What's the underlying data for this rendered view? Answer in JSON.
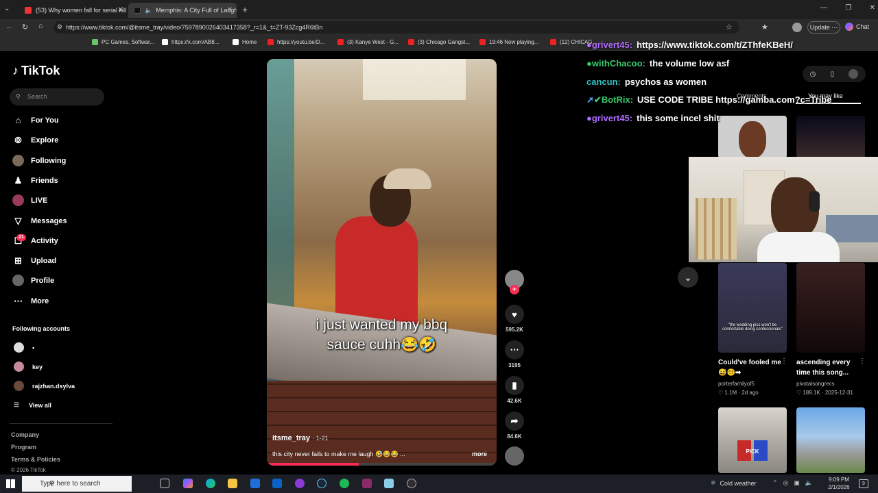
{
  "browser": {
    "tabs": [
      {
        "title": "(53) Why women fall for serial kill",
        "active": false
      },
      {
        "title": "Memphis: A City Full of Laugh",
        "active": true
      }
    ],
    "url": "https://www.tiktok.com/@itsme_tray/video/7597890026403417358?_r=1&_t=ZT-93Zcg4R6tBn",
    "update_label": "Update",
    "chat_label": "Chat",
    "bookmarks": [
      "PC Games, Softwar...",
      "https://x.com/AB8...",
      "Home",
      "https://youtu.be/D...",
      "(3) Kanye West - G...",
      "(3) Chicago Gangst...",
      "19:46 Now playing...",
      "(12) CHICAG"
    ]
  },
  "sidebar": {
    "logo": "TikTok",
    "search_placeholder": "Search",
    "nav": [
      {
        "label": "For You",
        "icon": "home-icon"
      },
      {
        "label": "Explore",
        "icon": "compass-icon"
      },
      {
        "label": "Following",
        "icon": "avatar"
      },
      {
        "label": "Friends",
        "icon": "friends-icon"
      },
      {
        "label": "LIVE",
        "icon": "avatar"
      },
      {
        "label": "Messages",
        "icon": "inbox-icon"
      },
      {
        "label": "Activity",
        "icon": "activity-icon",
        "badge": "21"
      },
      {
        "label": "Upload",
        "icon": "plus-icon"
      },
      {
        "label": "Profile",
        "icon": "avatar"
      },
      {
        "label": "More",
        "icon": "ellipsis-icon"
      }
    ],
    "following_header": "Following accounts",
    "following": [
      "•",
      "key",
      "rajzhan.dsylva"
    ],
    "view_all": "View all",
    "footer": [
      "Company",
      "Program",
      "Terms & Policies",
      "© 2026 TikTok"
    ]
  },
  "video": {
    "caption_line1": "i just wanted my bbq",
    "caption_line2": "sauce cuhh😂🤣",
    "author": "itsme_tray",
    "date": "· 1-21",
    "description": "this city never fails to make me laugh 🤣😂😂 ...",
    "more": "more",
    "likes": "595.2K",
    "comments": "3195",
    "saves": "42.6K",
    "shares": "84.6K"
  },
  "chat": [
    {
      "user": "grivert45:",
      "msg": "https://www.tiktok.com/t/ZThfeKBeH/",
      "color": "#b06cff"
    },
    {
      "user": "withChacoo:",
      "msg": "the volume low asf",
      "color": "#36c96b"
    },
    {
      "user": "cancun:",
      "msg": "psychos as women",
      "color": "#2fc4c4"
    },
    {
      "user": "BotRix:",
      "msg": "USE CODE TRIBE https://gamba.com?c=Tribe",
      "color": "#36c96b"
    },
    {
      "user": "grivert45:",
      "msg": "this some incel shit",
      "color": "#b06cff"
    }
  ],
  "right_panel": {
    "tabs": [
      "Comments",
      "You may like"
    ],
    "cards": [
      {
        "title": "Could've fooled me 😅😵‍💫➡",
        "user": "porterfamilyof5",
        "stats": "♡ 1.1M · 2d ago",
        "thumb_text": "\"the wedding pics won't be comfortable doing confessionals\""
      },
      {
        "title": "ascending every time this song...",
        "user": "pivotalsongrecs",
        "stats": "♡ 189.1K · 2025-12-31",
        "thumb_text": ""
      }
    ],
    "thumb_pick_text": "PICK"
  },
  "taskbar": {
    "search_placeholder": "Type here to search",
    "weather": "Cold weather",
    "time": "9:09 PM",
    "date": "2/1/2026",
    "notif_count": "9"
  }
}
